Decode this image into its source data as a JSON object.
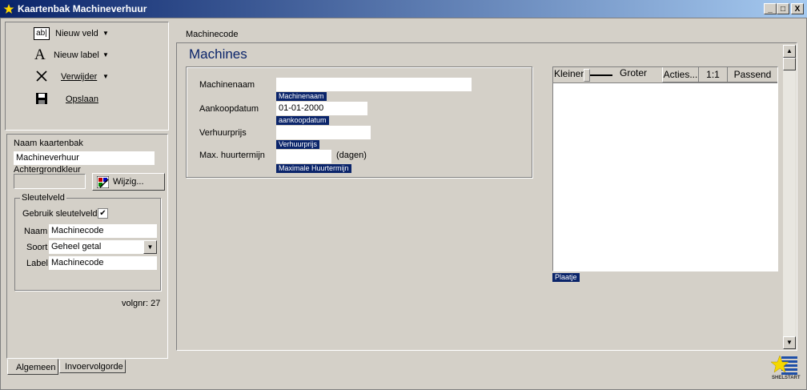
{
  "window": {
    "title": "Kaartenbak Machineverhuur",
    "controls": [
      "_",
      "□",
      "X"
    ]
  },
  "toolbar": {
    "new_field": "Nieuw veld",
    "new_label": "Nieuw label",
    "delete": "Verwijder",
    "save": "Opslaan"
  },
  "props": {
    "name_label": "Naam kaartenbak",
    "name_value": "Machineverhuur",
    "bgcolor_label": "Achtergrondkleur",
    "change_button": "Wijzig...",
    "keyfield_group": "Sleutelveld",
    "use_keyfield": "Gebruik sleutelveld",
    "naam_label": "Naam",
    "naam_value": "Machinecode",
    "soort_label": "Soort",
    "soort_value": "Geheel getal",
    "label_label": "Label",
    "label_value": "Machinecode",
    "volgnr": "volgnr: 27"
  },
  "tabs": [
    "Algemeen",
    "Invoervolgorde"
  ],
  "form": {
    "breadcrumb": "Machinecode",
    "title": "Machines",
    "fields": [
      {
        "label": "Machinenaam",
        "value": "",
        "tag": "Machinenaam"
      },
      {
        "label": "Aankoopdatum",
        "value": "01-01-2000",
        "tag": "aankoopdatum"
      },
      {
        "label": "Verhuurprijs",
        "value": "",
        "tag": "Verhuurprijs"
      },
      {
        "label": "Max. huurtermijn",
        "value": "",
        "tag": "Maximale Huurtermijn",
        "suffix": "(dagen)"
      }
    ],
    "image_panel": {
      "smaller": "Kleiner",
      "larger": "Groter",
      "actions": "Acties...",
      "one_to_one": "1:1",
      "fit": "Passend",
      "tag": "Plaatje"
    }
  },
  "logo": {
    "text": "SHELSTART"
  },
  "colors": {
    "title_start": "#0a246a",
    "title_end": "#a6caf0",
    "form_title": "#0a246a",
    "tag_bg": "#0a246a"
  }
}
